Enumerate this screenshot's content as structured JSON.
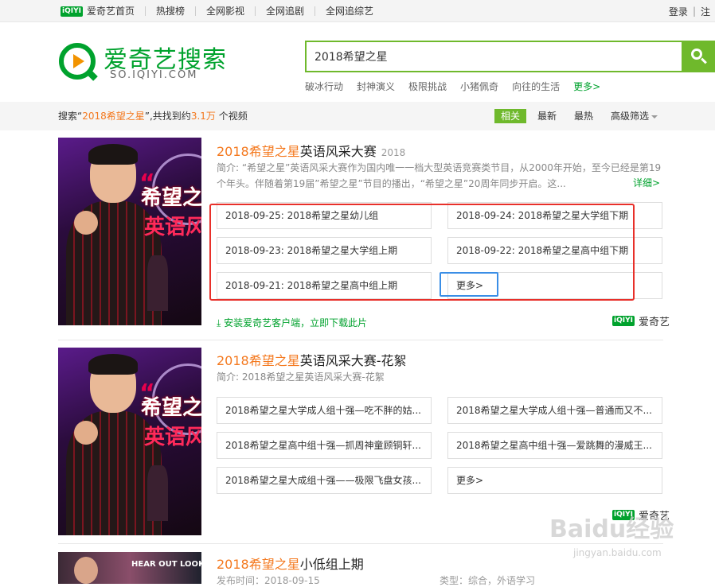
{
  "topbar": {
    "nav": [
      "爱奇艺首页",
      "热搜榜",
      "全网影视",
      "全网追剧",
      "全网追综艺"
    ],
    "brand_badge": "iQIYI",
    "login": "登录",
    "register": "注"
  },
  "logo": {
    "title": "爱奇艺搜索",
    "subtitle": "SO.IQIYI.COM"
  },
  "search": {
    "value": "2018希望之星",
    "hotwords": [
      "破冰行动",
      "封神演义",
      "极限挑战",
      "小猪佩奇",
      "向往的生活"
    ],
    "more": "更多>"
  },
  "filter": {
    "prefix": "搜索“",
    "query": "2018希望之星",
    "mid": "”,共找到约",
    "count": "3.1万",
    "suffix": "个视频",
    "tabs": [
      "相关",
      "最新",
      "最热",
      "高级筛选"
    ]
  },
  "results": [
    {
      "title_highlight": "2018希望之星",
      "title_rest": "英语风采大赛",
      "year": "2018",
      "desc_line1": "简介: “希望之星”英语风采大赛作为国内唯一一档大型英语竞赛类节目，从2000年开始，至今已经是第19",
      "desc_line2": "个年头。伴随着第19届”希望之星”节目的播出，“希望之星”20周年同步开启。这...",
      "detail": "详细>",
      "poster_text1": "希望之",
      "poster_text2": "英语风",
      "poster_quote": "“",
      "episodes": [
        "2018-09-25: 2018希望之星幼儿组",
        "2018-09-24: 2018希望之星大学组下期",
        "2018-09-23: 2018希望之星大学组上期",
        "2018-09-22: 2018希望之星高中组下期",
        "2018-09-21: 2018希望之星高中组上期",
        "更多>"
      ],
      "install": "安装爱奇艺客户端，立即下载此片",
      "brand": "爱奇艺"
    },
    {
      "title_highlight": "2018希望之星",
      "title_rest": "英语风采大赛-花絮",
      "desc_line1": "简介: 2018希望之星英语风采大赛-花絮",
      "poster_text1": "希望之",
      "poster_text2": "英语风",
      "poster_quote": "“",
      "episodes": [
        "2018希望之星大学成人组十强—吃不胖的姑...",
        "2018希望之星大学成人组十强—普通而又不...",
        "2018希望之星高中组十强—抓周神童顾铜轩...",
        "2018希望之星高中组十强—爱跳舞的漫威王...",
        "2018希望之星大成组十强——极限飞盘女孩...",
        "更多>"
      ],
      "brand": "爱奇艺"
    },
    {
      "title_highlight": "2018希望之星",
      "title_rest": "小低组上期",
      "meta_left": "发布时间：2018-09-15",
      "meta_right": "类型：综合，外语学习",
      "poster_text": "HEAR OUT LOOK"
    }
  ],
  "watermark": {
    "main": "Baidu经验",
    "sub": "jingyan.baidu.com"
  }
}
